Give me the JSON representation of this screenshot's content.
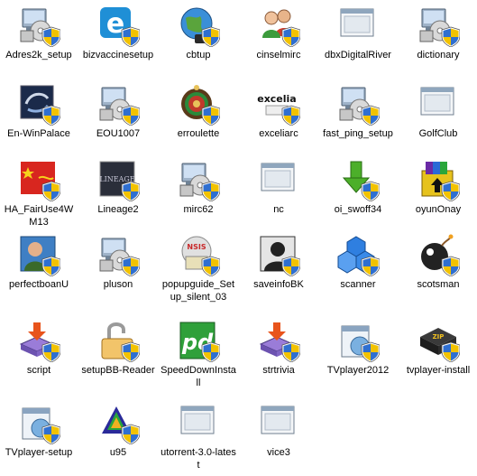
{
  "desktop": {
    "items": [
      {
        "label": "Adres2k_setup",
        "icon": "installer-cd-icon"
      },
      {
        "label": "bizvaccinesetup",
        "icon": "ie-logo-icon"
      },
      {
        "label": "cbtup",
        "icon": "globe-icon"
      },
      {
        "label": "cinselmirc",
        "icon": "users-icon"
      },
      {
        "label": "dbxDigitalRiver",
        "icon": "window-app-icon"
      },
      {
        "label": "dictionary",
        "icon": "installer-cd-icon"
      },
      {
        "label": "En-WinPalace",
        "icon": "winpalace-icon"
      },
      {
        "label": "EOU1007",
        "icon": "installer-cd-icon"
      },
      {
        "label": "erroulette",
        "icon": "roulette-icon"
      },
      {
        "label": "exceliarc",
        "icon": "excelia-icon"
      },
      {
        "label": "fast_ping_setup",
        "icon": "installer-cd-icon"
      },
      {
        "label": "GolfClub",
        "icon": "window-app-icon"
      },
      {
        "label": "HA_FairUse4WM13",
        "icon": "flag-icon"
      },
      {
        "label": "Lineage2",
        "icon": "lineage-icon"
      },
      {
        "label": "mirc62",
        "icon": "installer-cd-icon"
      },
      {
        "label": "nc",
        "icon": "window-app-icon"
      },
      {
        "label": "oi_swoff34",
        "icon": "green-down-arrow-icon"
      },
      {
        "label": "oyunOnay",
        "icon": "winrar-icon"
      },
      {
        "label": "perfectboanU",
        "icon": "person-icon"
      },
      {
        "label": "pluson",
        "icon": "installer-cd-icon"
      },
      {
        "label": "popupguide_Setup_silent_03",
        "icon": "nsis-icon"
      },
      {
        "label": "saveinfoBK",
        "icon": "silhouette-icon"
      },
      {
        "label": "scanner",
        "icon": "blue-cubes-icon"
      },
      {
        "label": "scotsman",
        "icon": "bomb-icon"
      },
      {
        "label": "script",
        "icon": "msi-installer-icon"
      },
      {
        "label": "setupBB-Reader",
        "icon": "padlock-icon"
      },
      {
        "label": "SpeedDownInstall",
        "icon": "pd-icon"
      },
      {
        "label": "strtrivia",
        "icon": "msi-installer-icon"
      },
      {
        "label": "TVplayer2012",
        "icon": "setup-box-icon"
      },
      {
        "label": "tvplayer-install",
        "icon": "zip-icon"
      },
      {
        "label": "TVplayer-setup",
        "icon": "setup-box-icon"
      },
      {
        "label": "u95",
        "icon": "utorrent-icon"
      },
      {
        "label": "utorrent-3.0-latest",
        "icon": "window-app-icon"
      },
      {
        "label": "vice3",
        "icon": "window-app-icon"
      }
    ]
  }
}
